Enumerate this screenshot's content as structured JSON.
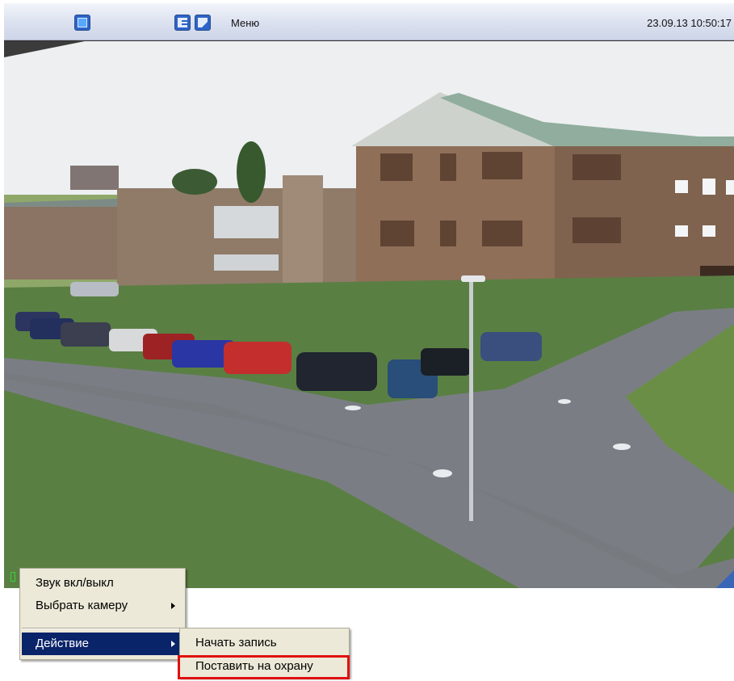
{
  "toolbar": {
    "menu_label": "Меню",
    "datetime": "23.09.13 10:50:17",
    "icons": [
      "camera-view-icon",
      "camera-list-icon",
      "arrow-up-right-icon"
    ]
  },
  "video": {
    "scene_icon": "camera-feed-image"
  },
  "context_menu": {
    "items": [
      {
        "label": "Звук вкл/выкл"
      },
      {
        "label": "Выбрать камеру"
      },
      {
        "label": "Действие"
      }
    ],
    "submenu": {
      "items": [
        {
          "label": "Начать запись"
        },
        {
          "label": "Поставить на охрану"
        }
      ]
    }
  },
  "colors": {
    "menu_highlight": "#0a246a",
    "annotation_box": "#e01010",
    "toolbar_accent": "#2d63c8"
  }
}
